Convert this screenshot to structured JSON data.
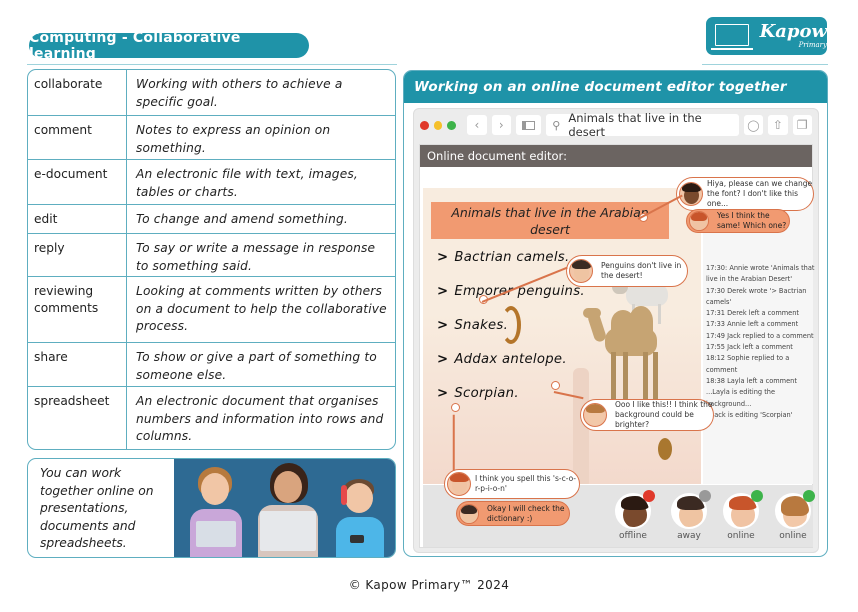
{
  "header": {
    "title": "Computing - Collaborative learning",
    "logo": {
      "brand": "Kapow",
      "sub": "Primary"
    }
  },
  "vocabulary": [
    {
      "term": "collaborate",
      "definition": "Working with others to achieve a specific goal."
    },
    {
      "term": "comment",
      "definition": "Notes to express an opinion on something."
    },
    {
      "term": "e-document",
      "definition": "An electronic file with text, images, tables or charts."
    },
    {
      "term": "edit",
      "definition": "To change and amend something."
    },
    {
      "term": "reply",
      "definition": "To say or write a message in response to something said."
    },
    {
      "term": "reviewing comments",
      "definition": "Looking at comments written by others on a document to help the collaborative process."
    },
    {
      "term": "share",
      "definition": "To show or give a part of something to someone else."
    },
    {
      "term": "spreadsheet",
      "definition": "An electronic document that organises numbers and information into rows and columns."
    }
  ],
  "note": {
    "text": "You can work together online on presentations, documents and spreadsheets."
  },
  "panel": {
    "title": "Working on an online document editor together",
    "browser": {
      "address": "Animals that live in the desert",
      "back_icon": "chevron-left",
      "forward_icon": "chevron-right",
      "sidebar_icon": "sidebar",
      "search_icon": "magnifier",
      "shield_icon": "shield",
      "share_icon": "share",
      "tabs_icon": "tabs"
    },
    "editor": {
      "bar_title": "Online document editor:",
      "doc_title": "Animals that live in the Arabian desert",
      "items": [
        "Bactrian camels.",
        "Emporer penguins.",
        "Snakes.",
        "Addax antelope.",
        "Scorpian."
      ],
      "bullet": ">"
    },
    "comments": [
      {
        "text": "Hiya, please can we change the font? I don't like this one...",
        "style": "outline"
      },
      {
        "text": "Yes I think the same! Which one?",
        "style": "filled"
      },
      {
        "text": "Penguins don't live in the desert!",
        "style": "outline"
      },
      {
        "text": "Ooo I like this!! I think the background could be brighter?",
        "style": "outline"
      },
      {
        "text": "I think you spell this 's-c-o-r-p-i-o-n'",
        "style": "outline"
      },
      {
        "text": "Okay I will check the dictionary :)",
        "style": "filled"
      }
    ],
    "activity_log": [
      "17:30: Annie wrote 'Animals that live in the Arabian Desert'",
      "17:30 Derek wrote '> Bactrian camels'",
      "17:31 Derek left a comment",
      "17:33 Annie left a comment",
      "17:49 Jack replied to a comment",
      "17:55 Jack left a comment",
      "18:12 Sophie replied to a comment",
      "18:38 Layla left a comment",
      "...Layla is editing the background...",
      "...Jack is editing 'Scorpian'"
    ],
    "users": [
      {
        "status": "offline",
        "color": "#e0392b"
      },
      {
        "status": "away",
        "color": "#999999"
      },
      {
        "status": "online",
        "color": "#3db34a"
      },
      {
        "status": "online",
        "color": "#3db34a"
      }
    ],
    "window_controls": {
      "close": "#e0392b",
      "minimize": "#f5c02a",
      "maximize": "#3db34a"
    }
  },
  "footer": "© Kapow Primary™ 2024",
  "colors": {
    "accent": "#1f93a8",
    "comment_orange": "#f19a71",
    "comment_border": "#d9744b"
  }
}
